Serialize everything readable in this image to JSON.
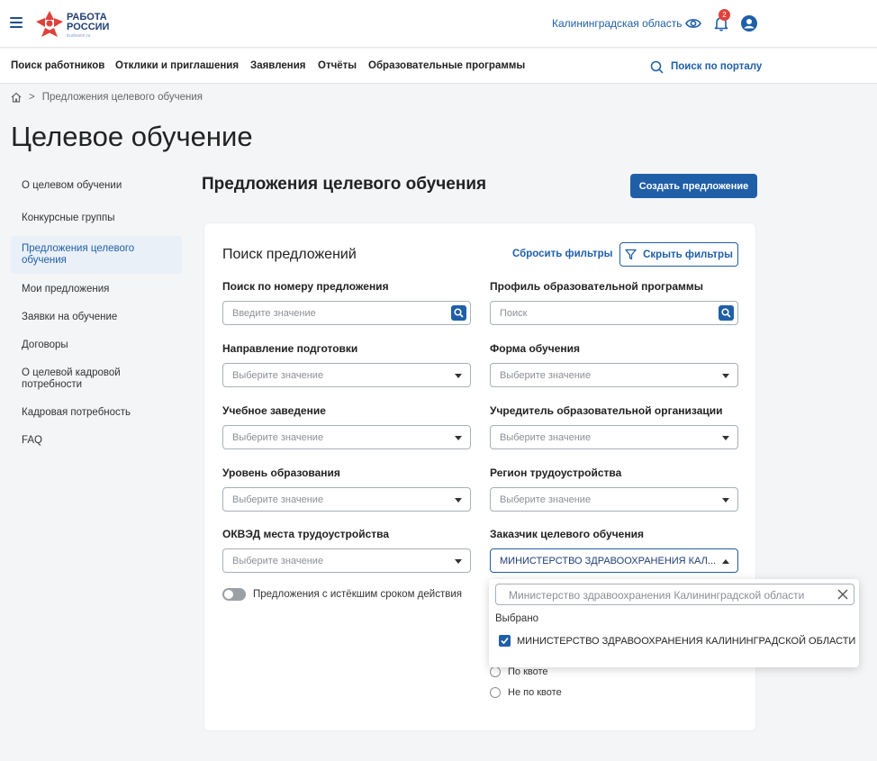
{
  "header": {
    "logo_line1": "РАБОТА",
    "logo_line2": "РОССИИ",
    "logo_sub": "trudvsem.ru",
    "region": "Калининградская область",
    "notification_count": "2"
  },
  "nav": {
    "items": [
      "Поиск работников",
      "Отклики и приглашения",
      "Заявления",
      "Отчёты",
      "Образовательные программы"
    ],
    "search_label": "Поиск по порталу"
  },
  "breadcrumb": {
    "separator": ">",
    "current": "Предложения целевого обучения"
  },
  "page_title": "Целевое обучение",
  "sidebar": {
    "items": [
      "О целевом обучении",
      "Конкурсные группы",
      "Предложения целевого обучения",
      "Мои предложения",
      "Заявки на обучение",
      "Договоры",
      "О целевой кадровой потребности",
      "Кадровая потребность",
      "FAQ"
    ],
    "active_index": 2
  },
  "section_title": "Предложения целевого обучения",
  "create_button": "Создать предложение",
  "filters": {
    "title": "Поиск предложений",
    "reset_label": "Сбросить фильтры",
    "hide_label": "Скрыть фильтры",
    "fields": {
      "offer_number": {
        "label": "Поиск по номеру предложения",
        "placeholder": "Введите значение"
      },
      "program_profile": {
        "label": "Профиль образовательной программы",
        "placeholder": "Поиск"
      },
      "direction": {
        "label": "Направление подготовки",
        "placeholder": "Выберите значение"
      },
      "study_form": {
        "label": "Форма обучения",
        "placeholder": "Выберите значение"
      },
      "institution": {
        "label": "Учебное заведение",
        "placeholder": "Выберите значение"
      },
      "founder": {
        "label": "Учредитель образовательной организации",
        "placeholder": "Выберите значение"
      },
      "education_level": {
        "label": "Уровень образования",
        "placeholder": "Выберите значение"
      },
      "employment_region": {
        "label": "Регион трудоустройства",
        "placeholder": "Выберите значение"
      },
      "okved": {
        "label": "ОКВЭД места трудоустройства",
        "placeholder": "Выберите значение"
      },
      "customer": {
        "label": "Заказчик целевого обучения",
        "value": "МИНИСТЕРСТВО ЗДРАВООХРАНЕНИЯ КАЛ..."
      }
    },
    "expired_toggle_label": "Предложения с истёкшим сроком действия",
    "quota_options": [
      "По квоте",
      "Не по квоте"
    ]
  },
  "customer_dropdown": {
    "search_value": "Министерство здравоохранения Калининградской области",
    "section_label": "Выбрано",
    "selected_option": "МИНИСТЕРСТВО ЗДРАВООХРАНЕНИЯ КАЛИНИНГРАДСКОЙ ОБЛАСТИ"
  },
  "colors": {
    "accent": "#1f5fa8",
    "logo_red": "#e0413a"
  }
}
